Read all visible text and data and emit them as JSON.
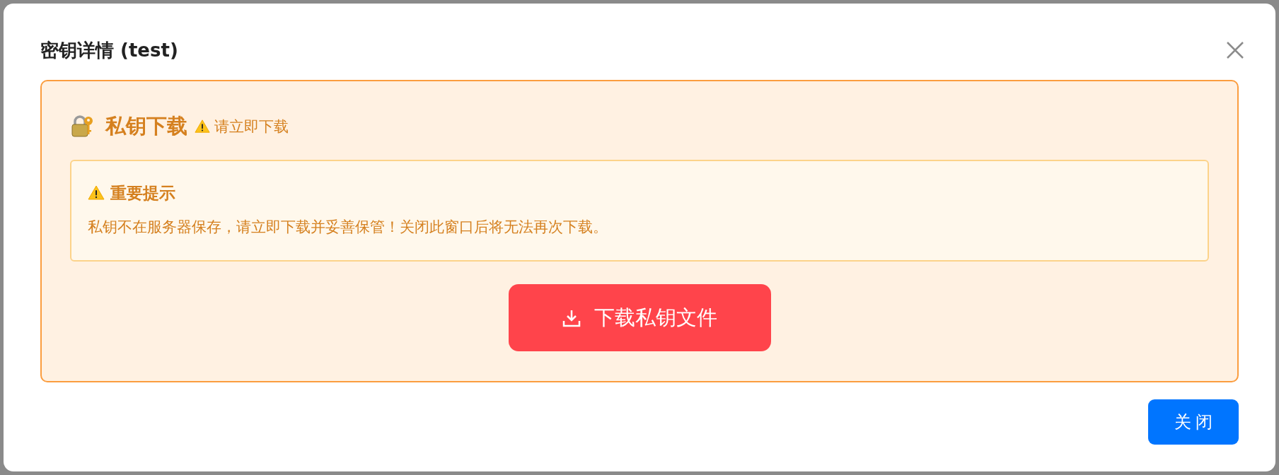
{
  "dialog": {
    "title": "密钥详情 (test)"
  },
  "panel": {
    "heading": "私钥下载",
    "hint": "请立即下载",
    "notice": {
      "title": "重要提示",
      "body": "私钥不在服务器保存，请立即下载并妥善保管！关闭此窗口后将无法再次下载。"
    },
    "download_button": "下载私钥文件"
  },
  "footer": {
    "close_button": "关 闭"
  }
}
